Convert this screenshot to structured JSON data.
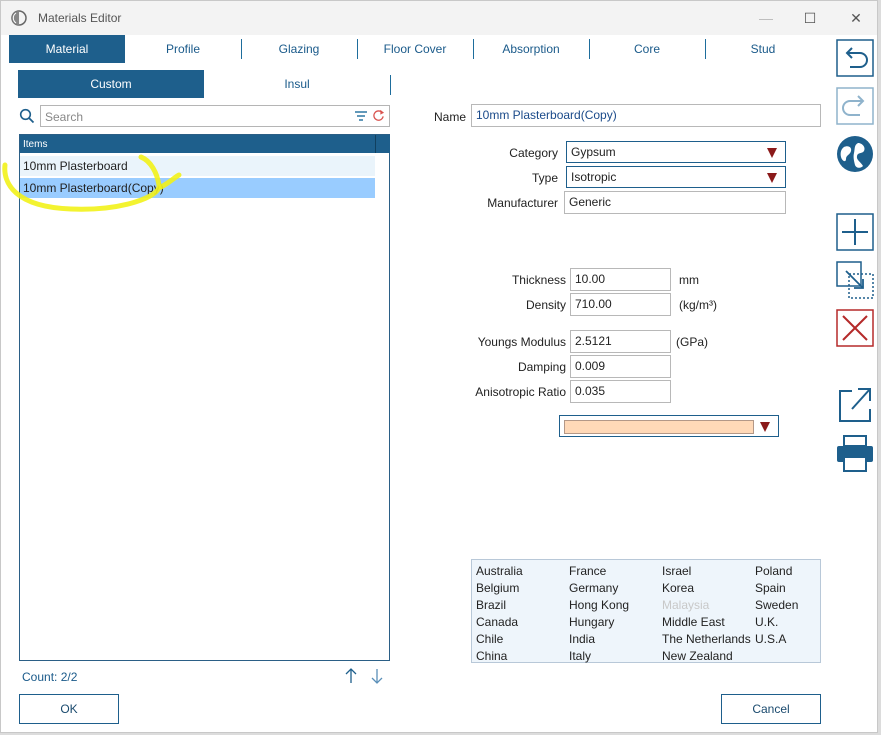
{
  "window": {
    "title": "Materials Editor"
  },
  "tabs": [
    {
      "label": "Material",
      "active": true
    },
    {
      "label": "Profile",
      "active": false
    },
    {
      "label": "Glazing",
      "active": false
    },
    {
      "label": "Floor Cover",
      "active": false
    },
    {
      "label": "Absorption",
      "active": false
    },
    {
      "label": "Core",
      "active": false
    },
    {
      "label": "Stud",
      "active": false
    }
  ],
  "subtabs": [
    {
      "label": "Custom",
      "active": true
    },
    {
      "label": "Insul",
      "active": false
    }
  ],
  "search": {
    "placeholder": "Search",
    "value": ""
  },
  "list": {
    "header": "Items",
    "items": [
      "10mm Plasterboard",
      "10mm Plasterboard(Copy)"
    ],
    "selected_index": 1,
    "count_text": "Count: 2/2"
  },
  "form": {
    "name_label": "Name",
    "name_value": "10mm Plasterboard(Copy)",
    "category_label": "Category",
    "category_value": "Gypsum",
    "type_label": "Type",
    "type_value": "Isotropic",
    "manufacturer_label": "Manufacturer",
    "manufacturer_value": "Generic",
    "thickness_label": "Thickness",
    "thickness_value": "10.00",
    "thickness_unit": "mm",
    "density_label": "Density",
    "density_value": "710.00",
    "density_unit": "(kg/m³)",
    "youngs_label": "Youngs Modulus",
    "youngs_value": "2.5121",
    "youngs_unit": "(GPa)",
    "damping_label": "Damping",
    "damping_value": "0.009",
    "aniso_label": "Anisotropic Ratio",
    "aniso_value": "0.035",
    "color_value": "#ffd9b8"
  },
  "countries": {
    "col1": [
      "Australia",
      "Belgium",
      "Brazil",
      "Canada",
      "Chile",
      "China"
    ],
    "col2": [
      "France",
      "Germany",
      "Hong Kong",
      "Hungary",
      "India",
      "Italy"
    ],
    "col3": [
      "Israel",
      "Korea",
      "Malaysia",
      "Middle East",
      "The Netherlands",
      "New Zealand"
    ],
    "col4": [
      "Poland",
      "Spain",
      "Sweden",
      "U.K.",
      "U.S.A"
    ],
    "disabled": [
      "Malaysia"
    ]
  },
  "buttons": {
    "ok": "OK",
    "cancel": "Cancel"
  },
  "side_toolbar": [
    "undo-icon",
    "redo-icon",
    "globe-icon",
    "add-icon",
    "duplicate-icon",
    "delete-icon",
    "export-icon",
    "print-icon"
  ],
  "colors": {
    "accent": "#1e5f8c",
    "selection": "#99ccff",
    "dropdown_arrow": "#8b1a1a",
    "highlight_annotation": "#f2f21a"
  }
}
